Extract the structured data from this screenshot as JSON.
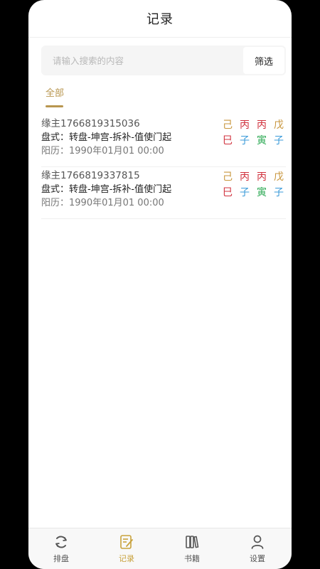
{
  "header": {
    "title": "记录"
  },
  "search": {
    "placeholder": "请输入搜索的内容",
    "value": "",
    "filter_label": "筛选"
  },
  "tabs": [
    {
      "label": "全部",
      "active": true
    }
  ],
  "records": [
    {
      "owner": "缘主1766819315036",
      "layout": "盘式：转盘-坤宫-拆补-值使门起",
      "date": "阳历：1990年01月01 00:00",
      "stems": [
        {
          "char": "己",
          "color": "#c8963c"
        },
        {
          "char": "丙",
          "color": "#d0303c"
        },
        {
          "char": "丙",
          "color": "#d0303c"
        },
        {
          "char": "戊",
          "color": "#c8963c"
        }
      ],
      "branches": [
        {
          "char": "巳",
          "color": "#d0303c"
        },
        {
          "char": "子",
          "color": "#3a9ad9"
        },
        {
          "char": "寅",
          "color": "#2eaa55"
        },
        {
          "char": "子",
          "color": "#3a9ad9"
        }
      ]
    },
    {
      "owner": "缘主1766819337815",
      "layout": "盘式：转盘-坤宫-拆补-值使门起",
      "date": "阳历：1990年01月01 00:00",
      "stems": [
        {
          "char": "己",
          "color": "#c8963c"
        },
        {
          "char": "丙",
          "color": "#d0303c"
        },
        {
          "char": "丙",
          "color": "#d0303c"
        },
        {
          "char": "戊",
          "color": "#c8963c"
        }
      ],
      "branches": [
        {
          "char": "巳",
          "color": "#d0303c"
        },
        {
          "char": "子",
          "color": "#3a9ad9"
        },
        {
          "char": "寅",
          "color": "#2eaa55"
        },
        {
          "char": "子",
          "color": "#3a9ad9"
        }
      ]
    }
  ],
  "tabbar": {
    "items": [
      {
        "label": "排盘",
        "icon": "refresh-cycle-icon",
        "active": false
      },
      {
        "label": "记录",
        "icon": "edit-note-icon",
        "active": true
      },
      {
        "label": "书籍",
        "icon": "books-icon",
        "active": false
      },
      {
        "label": "设置",
        "icon": "user-icon",
        "active": false
      }
    ],
    "active_color": "#c8a23c",
    "inactive_color": "#555555"
  }
}
